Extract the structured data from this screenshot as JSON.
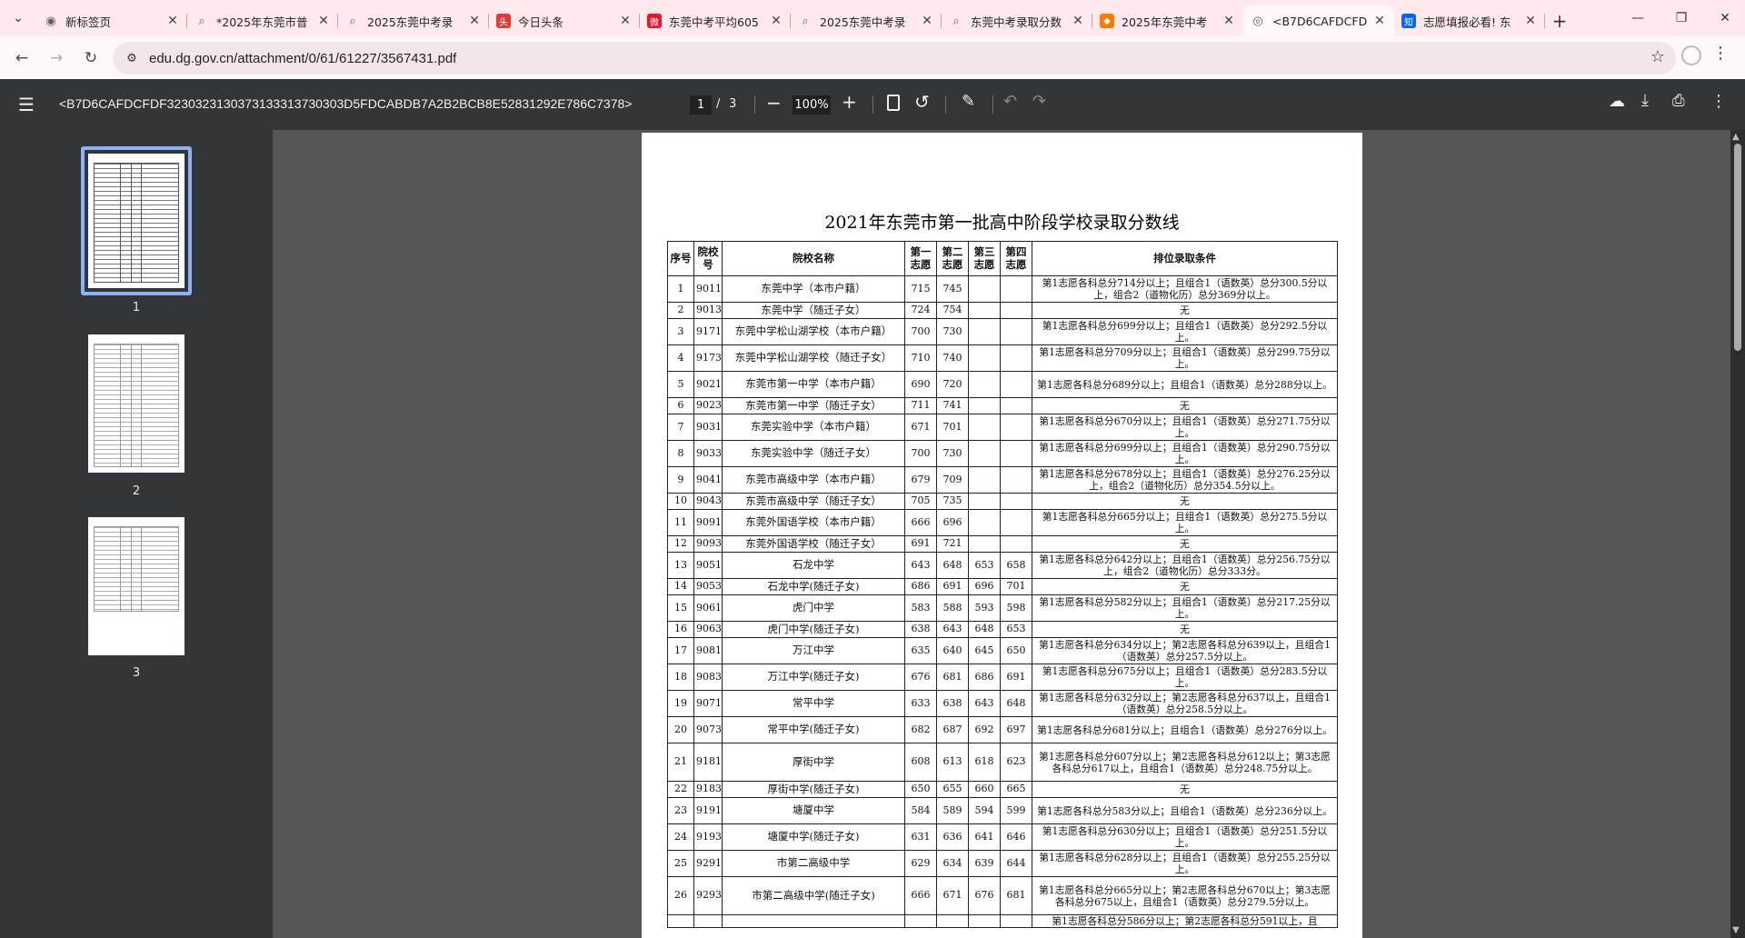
{
  "browser": {
    "tabs": [
      {
        "label": "新标签页",
        "icon": "chrome-icon",
        "color": "#5f6368"
      },
      {
        "label": "*2025年东莞市普",
        "icon": "search-icon",
        "color": "#5f6368"
      },
      {
        "label": "2025东莞中考录",
        "icon": "search-icon",
        "color": "#5f6368"
      },
      {
        "label": "今日头条",
        "icon": "toutiao-icon",
        "color": "#e53935"
      },
      {
        "label": "东莞中考平均605",
        "icon": "weibo-icon",
        "color": "#e6162d"
      },
      {
        "label": "2025东莞中考录",
        "icon": "search-icon",
        "color": "#5f6368"
      },
      {
        "label": "东莞中考录取分数",
        "icon": "search-icon",
        "color": "#5f6368"
      },
      {
        "label": "2025年东莞中考",
        "icon": "orange-app-icon",
        "color": "#ff7a00"
      },
      {
        "label": "<B7D6CAFDCFD",
        "icon": "globe-icon",
        "color": "#5f6368"
      },
      {
        "label": "志愿填报必看! 东",
        "icon": "zhihu-icon",
        "color": "#0066ff"
      }
    ],
    "active_tab_index": 8,
    "url": "edu.dg.gov.cn/attachment/0/61/61227/3567431.pdf"
  },
  "pdf_viewer": {
    "title": "<B7D6CAFDCFDF3230323130373133313730303D5FDCABDB7A2B2BCB8E52831292E786C7378>",
    "current_page": "1",
    "page_sep": "/",
    "total_pages": "3",
    "zoom": "100%",
    "thumbnails": [
      "1",
      "2",
      "3"
    ],
    "selected_thumbnail": 0
  },
  "document": {
    "title": "2021年东莞市第一批高中阶段学校录取分数线",
    "headers": [
      "序号",
      "院校号",
      "院校名称",
      "第一志愿",
      "第二志愿",
      "第三志愿",
      "第四志愿",
      "排位录取条件"
    ],
    "rows": [
      [
        "1",
        "9011",
        "东莞中学（本市户籍）",
        "715",
        "745",
        "",
        "",
        "第1志愿各科总分714分以上；且组合1（语数英）总分300.5分以上，组合2（道物化历）总分369分以上。"
      ],
      [
        "2",
        "9013",
        "东莞中学（随迁子女）",
        "724",
        "754",
        "",
        "",
        "无"
      ],
      [
        "3",
        "9171",
        "东莞中学松山湖学校（本市户籍）",
        "700",
        "730",
        "",
        "",
        "第1志愿各科总分699分以上；且组合1（语数英）总分292.5分以上。"
      ],
      [
        "4",
        "9173",
        "东莞中学松山湖学校（随迁子女）",
        "710",
        "740",
        "",
        "",
        "第1志愿各科总分709分以上；且组合1（语数英）总分299.75分以上。"
      ],
      [
        "5",
        "9021",
        "东莞市第一中学（本市户籍）",
        "690",
        "720",
        "",
        "",
        "第1志愿各科总分689分以上；且组合1（语数英）总分288分以上。"
      ],
      [
        "6",
        "9023",
        "东莞市第一中学（随迁子女）",
        "711",
        "741",
        "",
        "",
        "无"
      ],
      [
        "7",
        "9031",
        "东莞实验中学（本市户籍）",
        "671",
        "701",
        "",
        "",
        "第1志愿各科总分670分以上；且组合1（语数英）总分271.75分以上。"
      ],
      [
        "8",
        "9033",
        "东莞实验中学（随迁子女）",
        "700",
        "730",
        "",
        "",
        "第1志愿各科总分699分以上；且组合1（语数英）总分290.75分以上。"
      ],
      [
        "9",
        "9041",
        "东莞市高级中学（本市户籍）",
        "679",
        "709",
        "",
        "",
        "第1志愿各科总分678分以上；且组合1（语数英）总分276.25分以上，组合2（道物化历）总分354.5分以上。"
      ],
      [
        "10",
        "9043",
        "东莞市高级中学（随迁子女）",
        "705",
        "735",
        "",
        "",
        "无"
      ],
      [
        "11",
        "9091",
        "东莞外国语学校（本市户籍）",
        "666",
        "696",
        "",
        "",
        "第1志愿各科总分665分以上；且组合1（语数英）总分275.5分以上。"
      ],
      [
        "12",
        "9093",
        "东莞外国语学校（随迁子女）",
        "691",
        "721",
        "",
        "",
        "无"
      ],
      [
        "13",
        "9051",
        "石龙中学",
        "643",
        "648",
        "653",
        "658",
        "第1志愿各科总分642分以上；且组合1（语数英）总分256.75分以上，组合2（道物化历）总分333分。"
      ],
      [
        "14",
        "9053",
        "石龙中学(随迁子女)",
        "686",
        "691",
        "696",
        "701",
        "无"
      ],
      [
        "15",
        "9061",
        "虎门中学",
        "583",
        "588",
        "593",
        "598",
        "第1志愿各科总分582分以上；且组合1（语数英）总分217.25分以上。"
      ],
      [
        "16",
        "9063",
        "虎门中学(随迁子女)",
        "638",
        "643",
        "648",
        "653",
        "无"
      ],
      [
        "17",
        "9081",
        "万江中学",
        "635",
        "640",
        "645",
        "650",
        "第1志愿各科总分634分以上；第2志愿各科总分639以上，且组合1（语数英）总分257.5分以上。"
      ],
      [
        "18",
        "9083",
        "万江中学(随迁子女)",
        "676",
        "681",
        "686",
        "691",
        "第1志愿各科总分675分以上；且组合1（语数英）总分283.5分以上。"
      ],
      [
        "19",
        "9071",
        "常平中学",
        "633",
        "638",
        "643",
        "648",
        "第1志愿各科总分632分以上；第2志愿各科总分637以上，且组合1（语数英）总分258.5分以上。"
      ],
      [
        "20",
        "9073",
        "常平中学(随迁子女)",
        "682",
        "687",
        "692",
        "697",
        "第1志愿各科总分681分以上；且组合1（语数英）总分276分以上。"
      ],
      [
        "21",
        "9181",
        "厚街中学",
        "608",
        "613",
        "618",
        "623",
        "第1志愿各科总分607分以上；第2志愿各科总分612以上；第3志愿各科总分617以上，且组合1（语数英）总分248.75分以上。"
      ],
      [
        "22",
        "9183",
        "厚街中学(随迁子女)",
        "650",
        "655",
        "660",
        "665",
        "无"
      ],
      [
        "23",
        "9191",
        "塘厦中学",
        "584",
        "589",
        "594",
        "599",
        "第1志愿各科总分583分以上；且组合1（语数英）总分236分以上。"
      ],
      [
        "24",
        "9193",
        "塘厦中学(随迁子女)",
        "631",
        "636",
        "641",
        "646",
        "第1志愿各科总分630分以上；且组合1（语数英）总分251.5分以上。"
      ],
      [
        "25",
        "9291",
        "市第二高级中学",
        "629",
        "634",
        "639",
        "644",
        "第1志愿各科总分628分以上；且组合1（语数英）总分255.25分以上。"
      ],
      [
        "26",
        "9293",
        "市第二高级中学(随迁子女)",
        "666",
        "671",
        "676",
        "681",
        "第1志愿各科总分665分以上；第2志愿各科总分670以上；第3志愿各科总分675以上，且组合1（语数英）总分279.5分以上。"
      ],
      [
        "",
        "",
        "",
        "",
        "",
        "",
        "",
        "第1志愿各科总分586分以上；第2志愿各科总分591以上，且"
      ]
    ]
  }
}
